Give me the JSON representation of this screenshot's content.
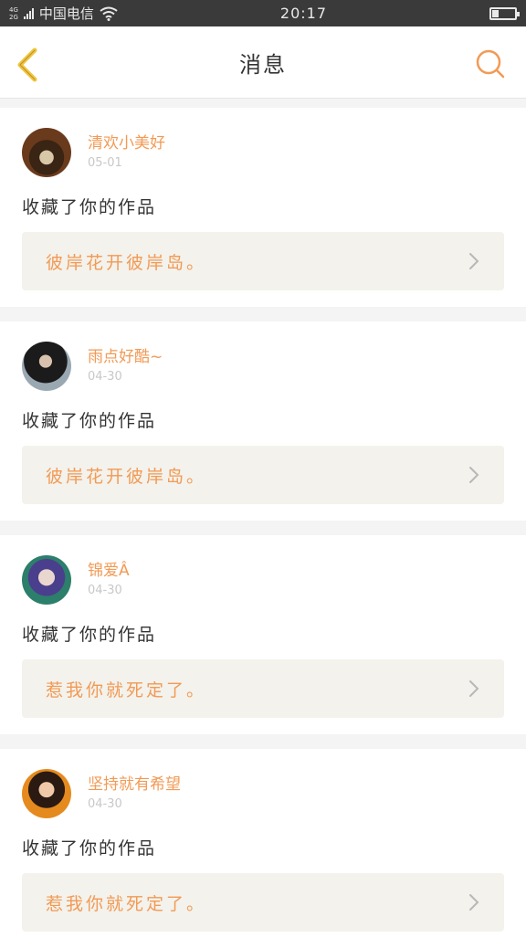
{
  "status_bar": {
    "net_gen_top": "4G",
    "net_gen_bottom": "2G",
    "carrier": "中国电信",
    "time": "20:17",
    "battery_level": 0.3
  },
  "header": {
    "title": "消息",
    "back_icon": "chevron-left-icon",
    "search_icon": "search-icon"
  },
  "messages": [
    {
      "username": "清欢小美好",
      "date": "05-01",
      "action": "收藏了你的作品",
      "work_title": "彼岸花开彼岸岛。"
    },
    {
      "username": "雨点好酷~",
      "date": "04-30",
      "action": "收藏了你的作品",
      "work_title": "彼岸花开彼岸岛。"
    },
    {
      "username": "锦爱Â",
      "date": "04-30",
      "action": "收藏了你的作品",
      "work_title": "惹我你就死定了。"
    },
    {
      "username": "坚持就有希望",
      "date": "04-30",
      "action": "收藏了你的作品",
      "work_title": "惹我你就死定了。"
    }
  ],
  "colors": {
    "accent": "#f29a55",
    "back_icon": "#f3c43c",
    "card_inner_bg": "#f3f2ec"
  }
}
